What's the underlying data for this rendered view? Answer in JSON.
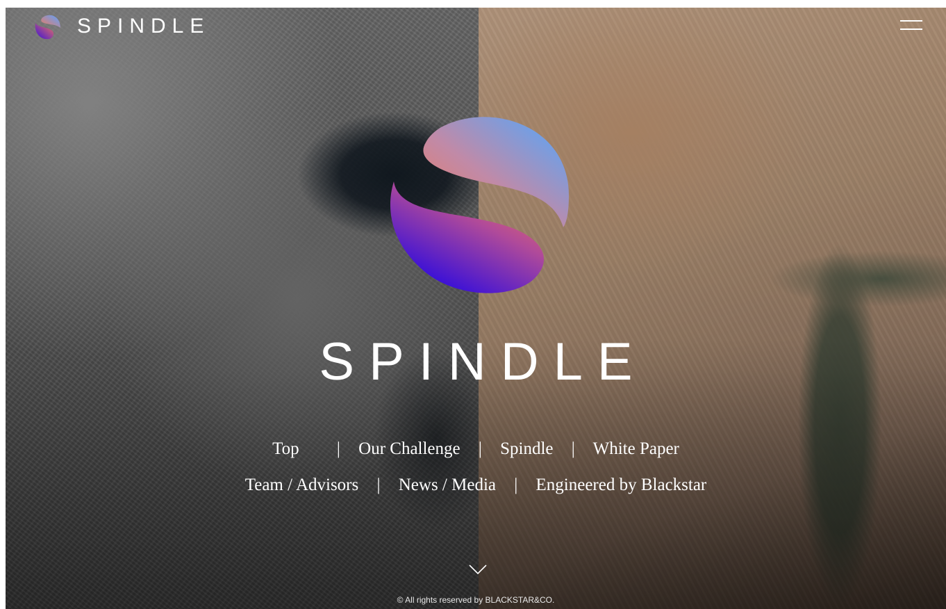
{
  "header": {
    "brand": "SPINDLE",
    "logo_icon": "spindle-sphere-logo",
    "menu_icon": "hamburger-icon"
  },
  "hero": {
    "emblem_icon": "spindle-s-emblem",
    "title": "SPINDLE",
    "emblem_colors": {
      "blue": "#5aa2ff",
      "coral": "#f07a5c",
      "violet": "#3a0fd8"
    }
  },
  "nav": {
    "row1": [
      {
        "label": "Top"
      },
      {
        "label": "Our Challenge"
      },
      {
        "label": "Spindle"
      },
      {
        "label": "White Paper"
      }
    ],
    "row2": [
      {
        "label": "Team / Advisors"
      },
      {
        "label": "News / Media"
      },
      {
        "label": "Engineered by Blackstar"
      }
    ],
    "separator": "|"
  },
  "scroll_indicator": {
    "icon": "chevron-down-icon"
  },
  "footer": {
    "copyright": "© All rights reserved by BLACKSTAR&CO."
  }
}
